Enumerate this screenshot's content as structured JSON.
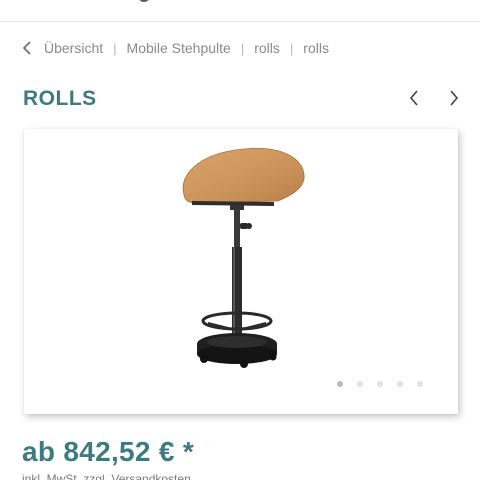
{
  "breadcrumb": {
    "items": [
      "Übersicht",
      "Mobile Stehpulte",
      "rolls",
      "rolls"
    ],
    "separator": "|"
  },
  "product": {
    "title": "ROLLS",
    "price": "ab 842,52 € *",
    "tax_note": "inkl. MwSt. zzgl. Versandkosten"
  },
  "gallery": {
    "image_subject": "mobile standing desk with curved wooden top, black pole, foot ring and round wheeled base",
    "slide_count": 5,
    "active_slide": 1
  },
  "icons": {
    "back": "chevron-left-icon",
    "prev": "chevron-left-icon",
    "next": "chevron-right-icon"
  },
  "colors": {
    "accent": "#3e7a7e",
    "breadcrumb_text": "#8a8a8a",
    "dot_active": "#b8b8d0",
    "dot_inactive": "#e0e0ec"
  }
}
